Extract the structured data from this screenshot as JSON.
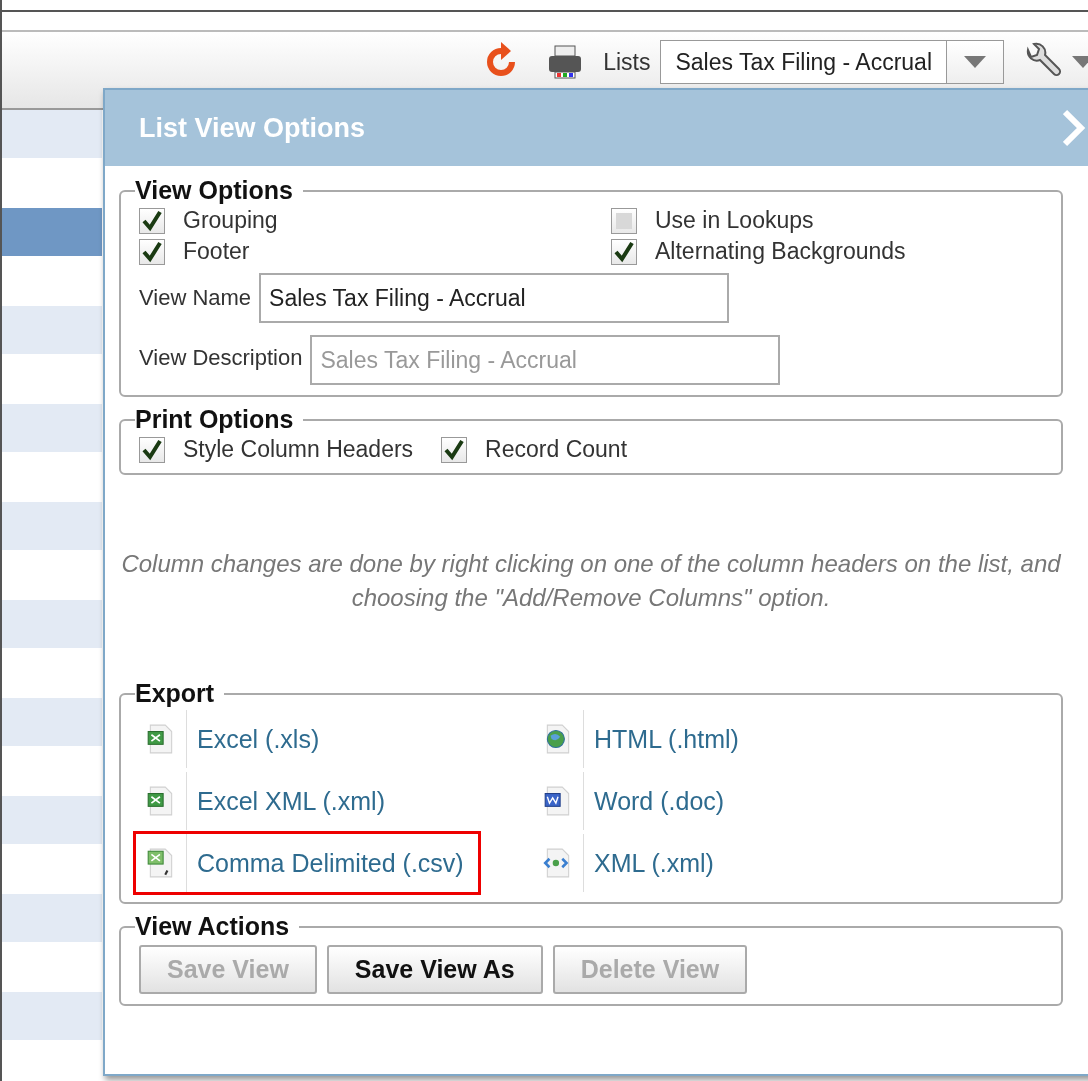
{
  "toolbar": {
    "lists_label": "Lists",
    "lists_value": "Sales Tax Filing - Accrual"
  },
  "list_rows": [
    {
      "selected": false
    },
    {
      "selected": false
    },
    {
      "selected": true
    },
    {
      "selected": false
    },
    {
      "selected": false
    },
    {
      "selected": false
    },
    {
      "selected": false
    },
    {
      "selected": false
    },
    {
      "selected": false
    },
    {
      "selected": false
    },
    {
      "selected": false
    },
    {
      "selected": false
    },
    {
      "selected": false
    },
    {
      "selected": false
    },
    {
      "selected": false
    },
    {
      "selected": false
    },
    {
      "selected": false
    },
    {
      "selected": false
    },
    {
      "selected": false
    }
  ],
  "dialog": {
    "title": "List View Options",
    "view_options": {
      "title": "View Options",
      "checkboxes": [
        {
          "label": "Grouping",
          "checked": true
        },
        {
          "label": "Use in Lookups",
          "checked": false
        },
        {
          "label": "Footer",
          "checked": true
        },
        {
          "label": "Alternating Backgrounds",
          "checked": true
        }
      ],
      "view_name": {
        "label": "View Name",
        "value": "Sales Tax Filing - Accrual"
      },
      "view_description": {
        "label": "View Description",
        "placeholder": "Sales Tax Filing - Accrual"
      }
    },
    "print_options": {
      "title": "Print Options",
      "checkboxes": [
        {
          "label": "Style Column Headers",
          "checked": true
        },
        {
          "label": "Record Count",
          "checked": true
        }
      ]
    },
    "note": "Column changes are done by right clicking on one of the column headers on the list, and choosing the \"Add/Remove Columns\" option.",
    "export": {
      "title": "Export",
      "items": [
        {
          "kind": "excel",
          "label": "Excel (.xls)",
          "highlighted": false
        },
        {
          "kind": "html",
          "label": "HTML (.html)",
          "highlighted": false
        },
        {
          "kind": "excel",
          "label": "Excel XML (.xml)",
          "highlighted": false
        },
        {
          "kind": "word",
          "label": "Word (.doc)",
          "highlighted": false
        },
        {
          "kind": "csv",
          "label": "Comma Delimited (.csv)",
          "highlighted": true
        },
        {
          "kind": "xml",
          "label": "XML (.xml)",
          "highlighted": false
        }
      ]
    },
    "view_actions": {
      "title": "View Actions",
      "buttons": [
        {
          "label": "Save View",
          "disabled": true
        },
        {
          "label": "Save View As",
          "disabled": false
        },
        {
          "label": "Delete View",
          "disabled": true
        }
      ]
    }
  }
}
